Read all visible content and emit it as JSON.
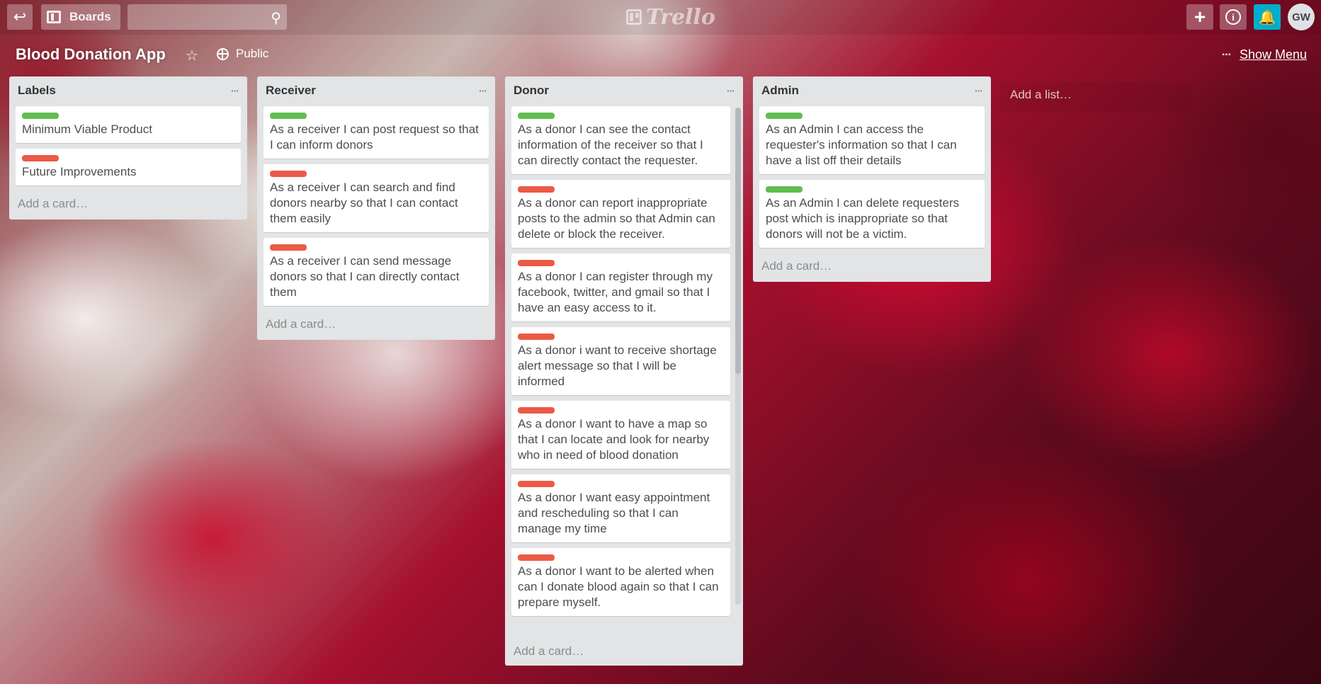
{
  "header": {
    "boards_label": "Boards",
    "search_placeholder": "",
    "logo_text": "Trello",
    "avatar_initials": "GW"
  },
  "board": {
    "title": "Blood Donation App",
    "visibility": "Public",
    "show_menu": "Show Menu"
  },
  "lists": [
    {
      "title": "Labels",
      "cards": [
        {
          "label": "green",
          "text": "Minimum Viable Product"
        },
        {
          "label": "red",
          "text": "Future Improvements"
        }
      ],
      "add_card": "Add a card…"
    },
    {
      "title": "Receiver",
      "cards": [
        {
          "label": "green",
          "text": "As a receiver I can post request so that I can inform donors"
        },
        {
          "label": "red",
          "text": "As a receiver I can search and find donors nearby so that I can contact them easily"
        },
        {
          "label": "red",
          "text": "As a receiver I can send message donors so that I can directly contact them"
        }
      ],
      "add_card": "Add a card…"
    },
    {
      "title": "Donor",
      "cards": [
        {
          "label": "green",
          "text": "As a donor I can see the contact information of the receiver so that I can directly contact the requester."
        },
        {
          "label": "red",
          "text": "As a donor can report inappropriate posts to the admin so that Admin can delete or block the receiver."
        },
        {
          "label": "red",
          "text": "As a donor I can register through my facebook, twitter, and gmail so that I have an easy access to it."
        },
        {
          "label": "red",
          "text": "As a donor i want to receive shortage alert message so that I will be informed"
        },
        {
          "label": "red",
          "text": "As a donor I want to have a map so that I can locate and look for nearby who in need of blood donation"
        },
        {
          "label": "red",
          "text": "As a donor I want easy appointment and rescheduling so that I can manage my time"
        },
        {
          "label": "red",
          "text": "As a donor I want to be alerted when can I donate blood again so that I can prepare myself."
        }
      ],
      "add_card": "Add a card…"
    },
    {
      "title": "Admin",
      "cards": [
        {
          "label": "green",
          "text": "As an Admin I can access the requester's information so that I can have a list off their details"
        },
        {
          "label": "green",
          "text": "As an Admin I can delete requesters post which is inappropriate so that donors will not be a victim."
        }
      ],
      "add_card": "Add a card…"
    }
  ],
  "add_list": "Add a list…",
  "colors": {
    "label_green": "#61bd4f",
    "label_red": "#eb5a46",
    "notification_blue": "#00aecc",
    "list_bg": "#e2e4e6"
  },
  "icons": [
    "back-arrow-icon",
    "boards-icon",
    "search-icon",
    "trello-logo-icon",
    "plus-icon",
    "info-icon",
    "bell-icon",
    "star-icon",
    "globe-icon",
    "more-dots-icon"
  ]
}
